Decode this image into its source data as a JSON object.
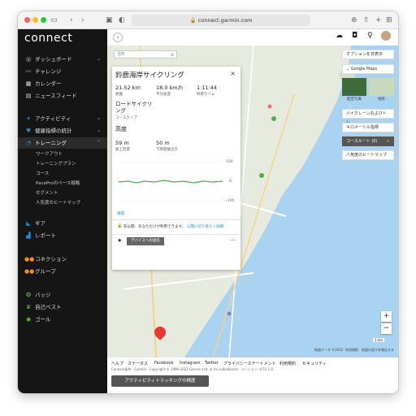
{
  "browser": {
    "url": "connect.garmin.com"
  },
  "sidebar": {
    "logo": "connect",
    "items": [
      {
        "label": "ダッシュボード",
        "icon": "dashboard-icon"
      },
      {
        "label": "チャレンジ",
        "icon": "challenge-icon"
      },
      {
        "label": "カレンダー",
        "icon": "calendar-icon"
      },
      {
        "label": "ニュースフィード",
        "icon": "news-icon"
      },
      {
        "label": "アクティビティ",
        "icon": "activity-icon"
      },
      {
        "label": "健康指標の統計",
        "icon": "heart-icon"
      },
      {
        "label": "トレーニング",
        "icon": "training-icon"
      },
      {
        "label": "ギア",
        "icon": "gear-shoe-icon"
      },
      {
        "label": "レポート",
        "icon": "report-icon"
      },
      {
        "label": "コネクション",
        "icon": "connections-icon"
      },
      {
        "label": "グループ",
        "icon": "group-icon"
      },
      {
        "label": "バッジ",
        "icon": "badge-icon"
      },
      {
        "label": "自己ベスト",
        "icon": "trophy-icon"
      },
      {
        "label": "ゴール",
        "icon": "goal-icon"
      }
    ],
    "training_sub": [
      "ワークアウト",
      "トレーニングプラン",
      "コース",
      "PaceProのペース戦略",
      "セグメント",
      "人気度のヒートマップ"
    ]
  },
  "panel": {
    "search_placeholder": "住所",
    "title": "鈴鹿海岸サイクリング",
    "stats": [
      {
        "value": "21.52 km",
        "label": "距離"
      },
      {
        "value": "18.0 km/h",
        "label": "平均速度"
      },
      {
        "value": "1:11:44",
        "label": "目標タイム"
      }
    ],
    "course_type_value": "ロードサイクリング",
    "course_type_label": "コースタイプ",
    "elevation_title": "高度",
    "elev": [
      {
        "value": "59 m",
        "label": "総上昇量"
      },
      {
        "value": "50 m",
        "label": "下降距離合計"
      }
    ],
    "chart_ticks": [
      "100",
      "0",
      "−100"
    ],
    "chart_link": "展開",
    "privacy_text": "非公開：あなただけが利用できます。",
    "privacy_link": "公開に切り替え・詳細",
    "send_button": "デバイスへの送信",
    "more": "..."
  },
  "map_controls": {
    "hide_options": "オプションを非表示",
    "google_maps": "Google Maps",
    "aerial": "航空写真",
    "terrain": "地形",
    "bike_lanes": "バイクレーンおよびトレ...",
    "km_markers": "キロメートル指標",
    "course_route": "コースルート (0)",
    "heatmap": "人気度のヒートマップ",
    "zoom_in": "+",
    "zoom_out": "−",
    "scale": "1 km",
    "map_data": "地図データ ©2022",
    "terms": "利用規約",
    "report": "地図の誤りを報告する"
  },
  "footer": {
    "links": [
      "ヘルプ",
      "ステータス",
      "Facebook",
      "Instagram",
      "Twitter",
      "プライバシーステートメント",
      "利用規約",
      "セキュリティ"
    ],
    "copyright": "Connect条件 · Garmin · Copyright © 1996-2022 Garmin Ltd. or its subsidiaries · バージョン: 4.51.1.0,",
    "tracking_button": "アクティビティトラッキングの精度"
  },
  "colors": {
    "sidebar": "#151515",
    "accent": "#1a8fd6",
    "sea": "#a9d3f0",
    "land": "#e7eadf"
  }
}
